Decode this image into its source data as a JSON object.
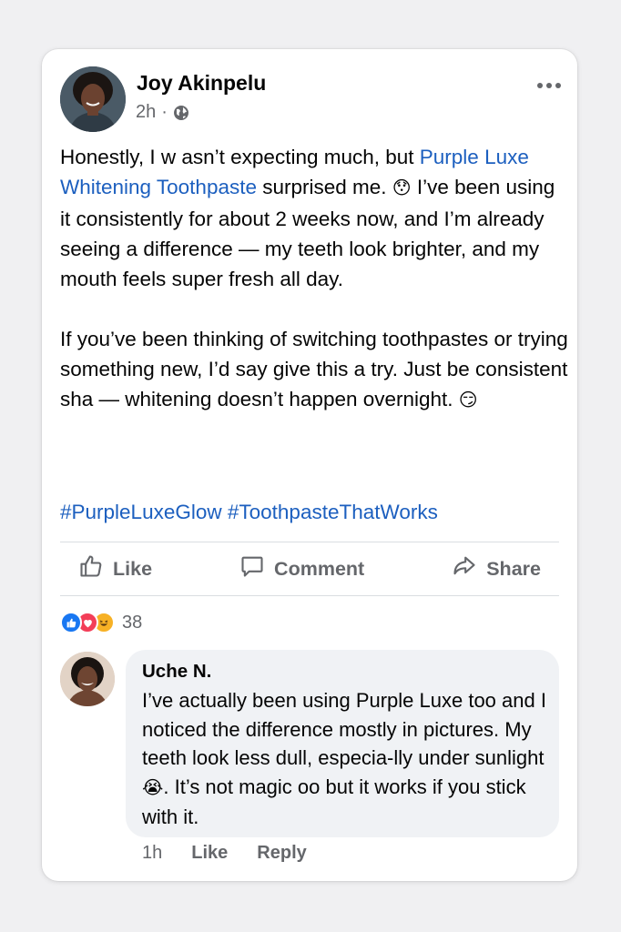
{
  "post": {
    "author": "Joy Akinpelu",
    "time": "2h",
    "separator": "·",
    "privacy_icon": "globe-icon",
    "more_icon": "more-options-icon",
    "text_p1_a": "Honestly, I w asn’t expecting much, but ",
    "text_p1_link": "Purple Luxe Whitening Toothpaste",
    "text_p1_b": " surprised me. ",
    "emoji_1": "😯",
    "text_p1_c": " I’ve been using it consistently for about 2 weeks now, and I’m already seeing a difference — my teeth look brighter, and my mouth feels super fresh all day.",
    "text_p2": "If you’ve been thinking of switching toothpastes or trying something new, I’d say give this a try. Just be consistent sha — whitening doesn’t happen overnight. ",
    "emoji_2": "😏",
    "hashtag_1": "#PurpleLuxeGlow",
    "hashtag_2": "#ToothpasteThatWorks"
  },
  "actions": {
    "like": "Like",
    "comment": "Comment",
    "share": "Share"
  },
  "reactions": {
    "icons": [
      "like-reaction-icon",
      "love-reaction-icon",
      "laugh-reaction-icon"
    ],
    "count": "38"
  },
  "comment": {
    "author": "Uche N.",
    "text_a": "I’ve actually been using Purple Luxe too and I noticed the difference mostly in pictures. My teeth look less dull, especia-lly under sunlight ",
    "emoji": "😭",
    "text_b": ". It’s not magic oo but it works if you stick with it.",
    "time": "1h",
    "like": "Like",
    "reply": "Reply"
  },
  "colors": {
    "link": "#1c5fbf",
    "muted": "#65676b",
    "like_blue": "#1877f2",
    "love_red": "#f33e58",
    "laugh_yellow": "#f7b125",
    "bubble_bg": "#f0f2f5"
  }
}
